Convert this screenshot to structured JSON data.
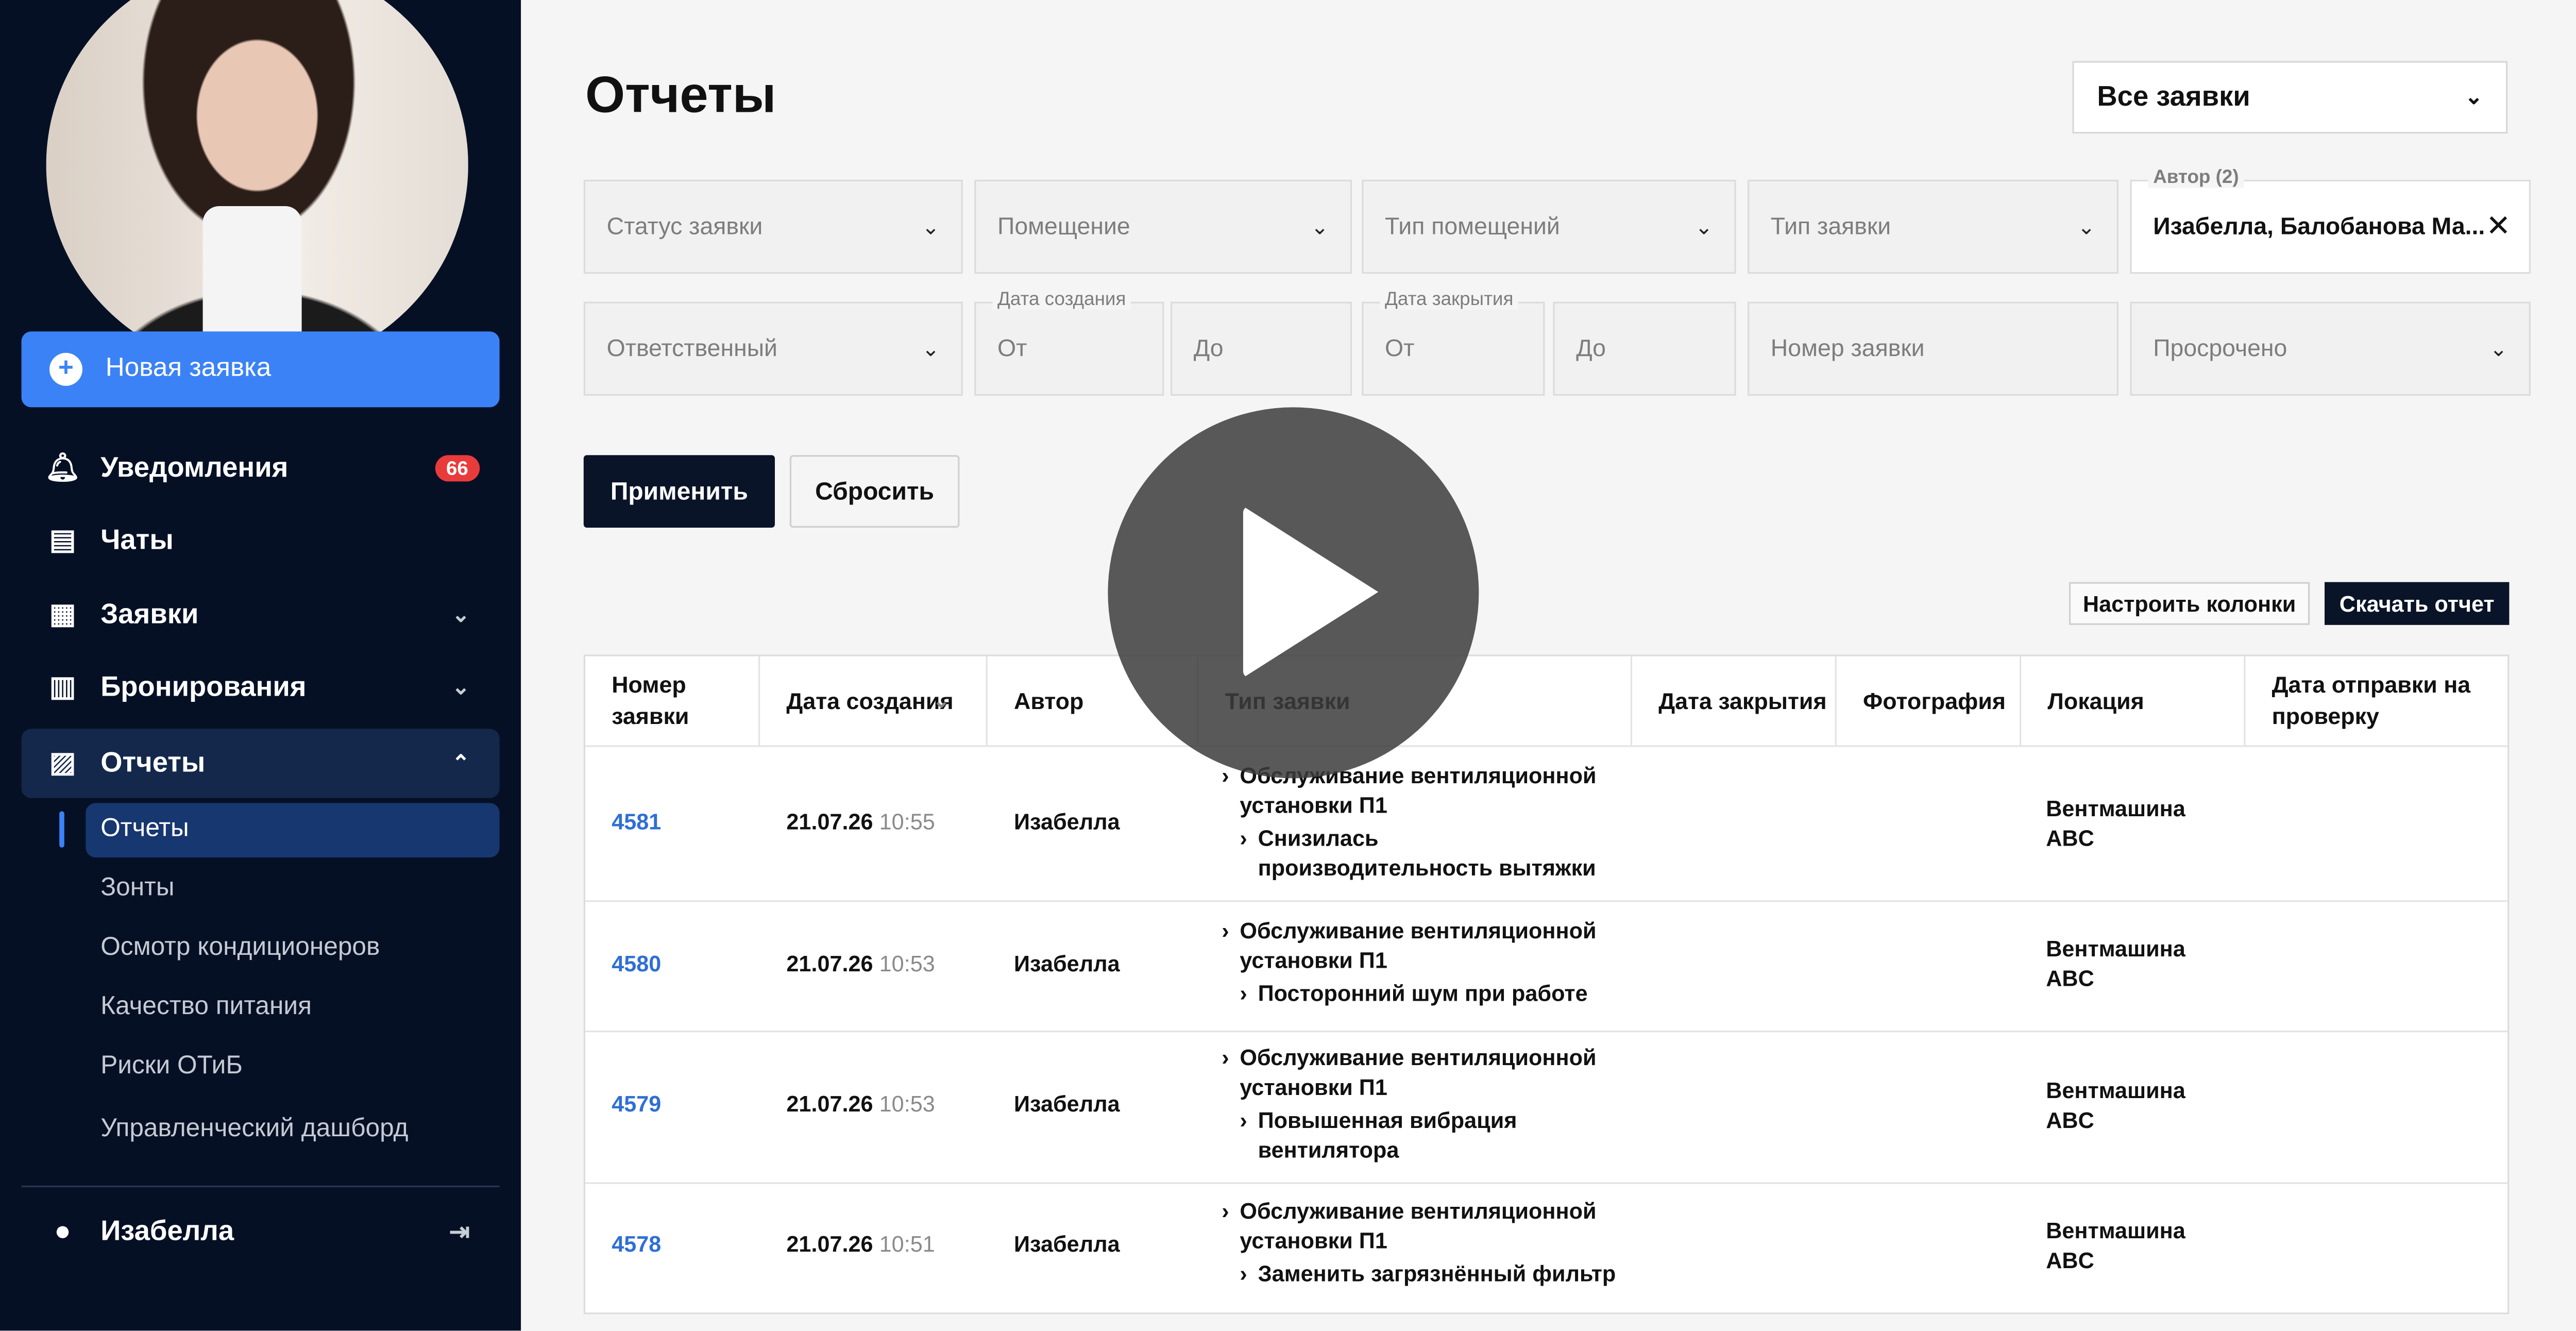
{
  "sidebar": {
    "new_request": "Новая заявка",
    "notifications": {
      "label": "Уведомления",
      "badge": "66"
    },
    "chats": "Чаты",
    "requests": "Заявки",
    "bookings": "Бронирования",
    "reports": "Отчеты",
    "sub_items": [
      "Отчеты",
      "Зонты",
      "Осмотр кондиционеров",
      "Качество питания",
      "Риски ОТиБ",
      "Управленческий дашборд"
    ],
    "user": "Изабелла"
  },
  "main": {
    "title": "Отчеты",
    "scope_select": "Все заявки",
    "filters": {
      "status": "Статус заявки",
      "room": "Помещение",
      "room_type": "Тип помещений",
      "request_type": "Тип заявки",
      "author_label": "Автор (2)",
      "author_value": "Изабелла, Балобанова Ма...",
      "responsible": "Ответственный",
      "created_label": "Дата создания",
      "created_from": "От",
      "created_to": "До",
      "closed_label": "Дата закрытия",
      "closed_from": "От",
      "closed_to": "До",
      "request_number": "Номер заявки",
      "overdue": "Просрочено"
    },
    "apply": "Применить",
    "reset": "Сбросить",
    "configure_columns": "Настроить колонки",
    "download_report": "Скачать отчет",
    "table": {
      "headers": [
        "Номер заявки",
        "Дата создания",
        "Автор",
        "Тип заявки",
        "Дата закрытия",
        "Фотография",
        "Локация",
        "Дата отправки на проверку"
      ],
      "rows": [
        {
          "num": "4581",
          "date": "21.07.26",
          "time": "10:55",
          "author": "Изабелла",
          "type1": "Обслуживание вентиляционной установки П1",
          "type2": "Снизилась производительность вытяжки",
          "location": "Вентмашина ABC"
        },
        {
          "num": "4580",
          "date": "21.07.26",
          "time": "10:53",
          "author": "Изабелла",
          "type1": "Обслуживание вентиляционной установки П1",
          "type2": "Посторонний шум при работе",
          "location": "Вентмашина ABC"
        },
        {
          "num": "4579",
          "date": "21.07.26",
          "time": "10:53",
          "author": "Изабелла",
          "type1": "Обслуживание вентиляционной установки П1",
          "type2": "Повышенная вибрация вентилятора",
          "location": "Вентмашина ABC"
        },
        {
          "num": "4578",
          "date": "21.07.26",
          "time": "10:51",
          "author": "Изабелла",
          "type1": "Обслуживание вентиляционной установки П1",
          "type2": "Заменить загрязнённый фильтр",
          "location": "Вентмашина ABC"
        }
      ]
    }
  },
  "colors": {
    "sidebar_bg": "#061025",
    "accent": "#3b82f6",
    "badge": "#e93b3b",
    "link": "#2f6fd6"
  }
}
